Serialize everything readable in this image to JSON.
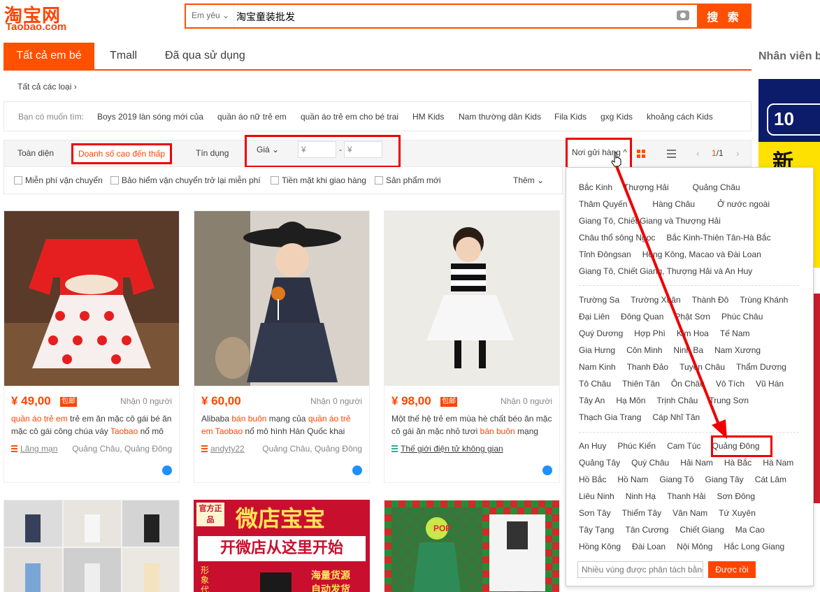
{
  "header": {
    "logo_cn": "淘宝网",
    "logo_en": "Taobao.com",
    "search_scope": "Em yêu ⌄",
    "search_value": "淘宝童装批发",
    "search_button": "搜 索"
  },
  "tabs": [
    "Tất cả em bé",
    "Tmall",
    "Đã qua sử dụng"
  ],
  "side": {
    "title": "Nhân viên b",
    "banner_num": "10",
    "banner_text": "新手"
  },
  "breadcrumb": "Tất cả các loại ›",
  "suggest": {
    "label": "Bạn có muốn tìm:",
    "items": [
      "Boys 2019 làn sóng mới của",
      "quần áo nữ trẻ em",
      "quần áo trẻ em cho bé trai",
      "HM Kids",
      "Nam thường dân Kids",
      "Fila Kids",
      "gxg Kids",
      "khoảng cách Kids"
    ]
  },
  "sort": {
    "overall": "Toàn diện",
    "sales": "Doanh số cao đến thấp",
    "credit": "Tín dụng",
    "price": "Giá ⌄",
    "price_min": "¥",
    "price_dash": "-",
    "price_max": "¥",
    "ship_from": "Nơi gửi hàng ^",
    "page": "1",
    "page_total": "/1"
  },
  "filters": [
    "Miễn phí vận chuyển",
    "Bảo hiểm vận chuyển trở lại miễn phí",
    "Tiền mặt khi giao hàng",
    "Sản phẩm mới"
  ],
  "filters_more": "Thêm ⌄",
  "products": [
    {
      "price": "¥ 49,00",
      "badge": "包邮",
      "deal": "Nhận 0 người",
      "title_hl1": "quần áo trẻ em",
      "title_a": " trẻ em ăn mặc cô gái bé ăn mặc cô gái công chúa váy ",
      "title_hl2": "Taobao",
      "title_b": " nổ mô",
      "shop": "Lãng mạn",
      "loc": "Quảng Châu, Quảng Đông"
    },
    {
      "price": "¥ 60,00",
      "badge": "",
      "deal": "Nhận 0 người",
      "title_pre": "Alibaba ",
      "title_hl1": "bán buôn",
      "title_a": " mạng của ",
      "title_hl2": "quần áo trẻ em Taobao",
      "title_b": " nổ mô hình Hàn Quốc khai",
      "shop": "andyty22",
      "loc": "Quảng Châu, Quảng Đông"
    },
    {
      "price": "¥ 98,00",
      "badge": "包邮",
      "deal": "Nhận 0 người",
      "title_a": "Một thế hệ trẻ em mùa hè chất béo ăn mặc cô gái ăn mặc nhỏ tươi ",
      "title_hl1": "bán buôn",
      "title_b": " mạng",
      "shop": "Thế giới điện tử không gian",
      "loc": ""
    }
  ],
  "promo": {
    "line1": "微店宝宝",
    "line2": "开微店从这里开始",
    "tag": "官方正品",
    "f1": "海量货源",
    "f2": "自动发货",
    "side": "形象代",
    "pop": "POP"
  },
  "dropdown": {
    "rows_a": [
      [
        "Bắc Kinh",
        "Thượng Hải",
        "Quảng Châu"
      ],
      [
        "Thâm Quyến",
        "Hàng Châu",
        "Ở nước ngoài"
      ],
      [
        "Giang Tô, Chiết Giang và Thượng Hải"
      ],
      [
        "Châu thổ sông Ngọc",
        "Bắc Kinh-Thiên Tân-Hà Bắc"
      ],
      [
        "Tỉnh Đôngsan",
        "Hồng Kông, Macao và Đài Loan"
      ],
      [
        "Giang Tô, Chiết Giang, Thượng Hải và An Huy"
      ]
    ],
    "rows_b": [
      [
        "Trường Sa",
        "Trường Xuân",
        "Thành Đô",
        "Trùng Khánh"
      ],
      [
        "Đại Liên",
        "Đông Quan",
        "Phật Sơn",
        "Phúc Châu"
      ],
      [
        "Quý Dương",
        "Hợp Phì",
        "Kim Hoa",
        "Tế Nam"
      ],
      [
        "Gia Hưng",
        "Côn Minh",
        "Ninh Ba",
        "Nam Xương"
      ],
      [
        "Nam Kinh",
        "Thanh Đảo",
        "Tuyền Châu",
        "Thẩm Dương"
      ],
      [
        "Tô Châu",
        "Thiên Tân",
        "Ôn Châu",
        "Vô Tích",
        "Vũ Hán"
      ],
      [
        "Tây An",
        "Hạ Môn",
        "Trịnh Châu",
        "Trung Sơn"
      ],
      [
        "Thạch Gia Trang",
        "Cáp Nhĩ Tân"
      ]
    ],
    "rows_c": [
      [
        "An Huy",
        "Phúc Kiến",
        "Cam Túc",
        "Quảng Đông"
      ],
      [
        "Quảng Tây",
        "Quý Châu",
        "Hải Nam",
        "Hà Bắc",
        "Hà Nam"
      ],
      [
        "Hồ Bắc",
        "Hồ Nam",
        "Giang Tô",
        "Giang Tây",
        "Cát Lâm"
      ],
      [
        "Liêu Ninh",
        "Ninh Hạ",
        "Thanh Hải",
        "Sơn Đông"
      ],
      [
        "Sơn Tây",
        "Thiểm Tây",
        "Vân Nam",
        "Tứ Xuyên"
      ],
      [
        "Tây Tạng",
        "Tân Cương",
        "Chiết Giang",
        "Ma Cao"
      ],
      [
        "Hồng Kông",
        "Đài Loan",
        "Nội Mông",
        "Hắc Long Giang"
      ]
    ],
    "input_placeholder": "Nhiều vùng được phân tách bằng",
    "ok_button": "Được rồi"
  },
  "colors": {
    "accent": "#ff5000",
    "highlight_box": "#e00000"
  }
}
